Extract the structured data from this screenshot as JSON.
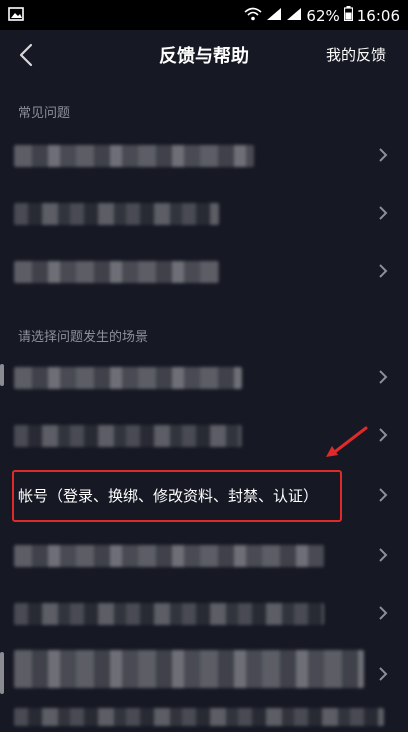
{
  "status_bar": {
    "battery": "62%",
    "time": "16:06"
  },
  "header": {
    "title": "反馈与帮助",
    "right_link": "我的反馈"
  },
  "sections": {
    "faq_label": "常见问题",
    "scene_label": "请选择问题发生的场景"
  },
  "highlighted_row": {
    "label": "帐号（登录、换绑、修改资料、封禁、认证）"
  },
  "colors": {
    "background": "#161823",
    "highlight": "#e02a2a",
    "muted_text": "#8e8f99"
  },
  "icons": {
    "back": "chevron-left-icon",
    "row_chevron": "chevron-right-icon",
    "annotation": "red-arrow-icon"
  }
}
